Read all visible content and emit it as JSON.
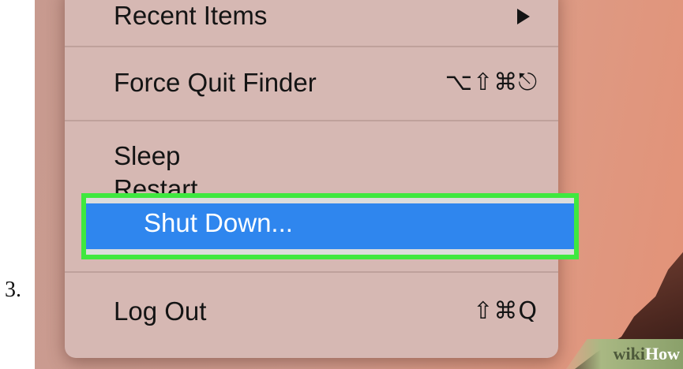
{
  "step": {
    "number": "3."
  },
  "menu": {
    "items": [
      {
        "label": "Recent Items",
        "has_submenu": true
      },
      {
        "label": "Force Quit Finder",
        "shortcut": "⌥⇧⌘⎋"
      },
      {
        "label": "Sleep"
      },
      {
        "label": "Restart..."
      },
      {
        "label": "Shut Down...",
        "selected": true
      },
      {
        "label": "Log Out",
        "shortcut": "⇧⌘Q"
      }
    ]
  },
  "watermark": {
    "part1": "wiki",
    "part2": "How"
  },
  "colors": {
    "menu_background": "#d6b8b3",
    "selection_blue": "#2f86ee",
    "highlight_green": "#3fe83f"
  }
}
